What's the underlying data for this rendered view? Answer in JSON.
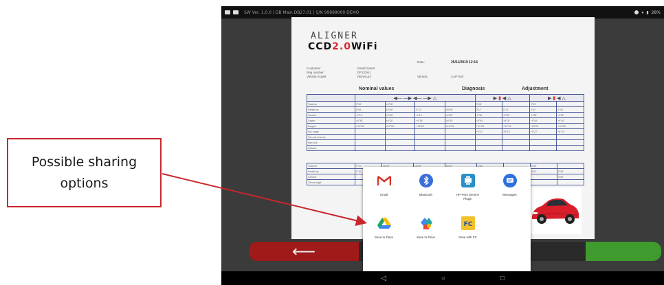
{
  "annotation": {
    "callout_text": "Possible sharing\noptions",
    "accent_color": "#c9262c"
  },
  "status_bar": {
    "text": "SW Ver. 1.0.0 | DB Main DB27.01 | S/N 99999000 DEMO",
    "right_text": "28%"
  },
  "report": {
    "logo_top": "ALIGNER",
    "logo_ccd_a": "CCD",
    "logo_ccd_b": "2.0",
    "logo_ccd_c": "WiFi",
    "date_label": "Date:",
    "date_value": "25/11/2019 12:14",
    "customer_label": "Customer:",
    "customer_value": "David Garret",
    "reg_label": "Reg number:",
    "reg_value": "DF123HJ",
    "model_label": "Vehicle model:",
    "model_value": "RENAULT",
    "vehicle_label": "Vehicle:",
    "vehicle_value": "CAPTUR",
    "section_nominal": "Nominal values",
    "section_diagnosis": "Diagnosis",
    "section_adjustment": "Adjustment",
    "rows_top": [
      [
        "Total toe",
        "0°10'",
        "±0°08'",
        "",
        "",
        "0°08'",
        "",
        "0°09'",
        ""
      ],
      [
        "Partial toe",
        "0°05'",
        "±0°08'",
        "0°12'",
        "±0°08'",
        "0°17'",
        "0°11'",
        "0°07'",
        "0°03'"
      ],
      [
        "Camber",
        "-1°14'",
        "±0°30'",
        "-1°14'",
        "±0°30'",
        "-1°36'",
        "-0°55'",
        "-1°36'",
        "-0°55'"
      ],
      [
        "Caster",
        "+4°38'",
        "±0°30'",
        "+4°38'",
        "±0°30'",
        "+5°04'",
        "+5°02'",
        "+5°04'",
        "+5°02'"
      ],
      [
        "Kingpin",
        "+10°28'",
        "±10°26'",
        "+10°53'",
        "±10°26'",
        "+10°23'",
        "+10°23'",
        "+10°23'",
        "+10°23'"
      ],
      [
        "Incl. angle",
        "",
        "",
        "",
        "",
        "+9°27'",
        "+8°23'",
        "+9°27'",
        "+8°23'"
      ],
      [
        "Toe-out on turns",
        "",
        "",
        "",
        "",
        "",
        "",
        "",
        ""
      ],
      [
        "Max lock",
        "",
        "",
        "",
        "",
        "",
        "",
        "",
        ""
      ],
      [
        "Setback",
        "",
        "",
        "",
        "",
        "",
        "",
        "",
        ""
      ]
    ],
    "rows_bottom": [
      [
        "Total toe",
        "0°10'",
        "±0°17'",
        "±0°02'",
        "±0°17'",
        "0°02'",
        "",
        "0°05'",
        ""
      ],
      [
        "Partial toe",
        "0°10'",
        "±0°17'",
        "±0°02'",
        "±0°17'",
        "0°02'",
        "0°08'",
        "0°02'",
        "0°08'"
      ],
      [
        "Camber",
        "",
        "",
        "",
        "",
        "",
        "",
        "",
        "0°55'"
      ],
      [
        "Thrust angle",
        "",
        "",
        "",
        "",
        "",
        "",
        "",
        ""
      ]
    ]
  },
  "share_dialog": {
    "items": [
      {
        "label": "Gmail",
        "icon": "gmail-icon",
        "color": "#d93025"
      },
      {
        "label": "Bluetooth",
        "icon": "bluetooth-icon",
        "color": "#3a6fd8"
      },
      {
        "label": "HP Print Service\nPlugin",
        "icon": "hp-print-icon",
        "color": "#2a8fc9"
      },
      {
        "label": "Messages",
        "icon": "messages-icon",
        "color": "#2f6fe0"
      },
      {
        "label": "Save to Drive",
        "icon": "drive-icon",
        "color": "#1fa463"
      },
      {
        "label": "Save to Drive",
        "icon": "drive-alt-icon",
        "color": "#2aa6a0"
      },
      {
        "label": "Save with FC",
        "icon": "fc-icon",
        "color": "#f2c12e"
      }
    ]
  },
  "bottom_bar": {
    "back_symbol": "⟵",
    "back_color": "#a01a1a",
    "go_color": "#3f9b2e"
  },
  "nav": {
    "back": "◁",
    "home": "○",
    "recents": "□"
  }
}
